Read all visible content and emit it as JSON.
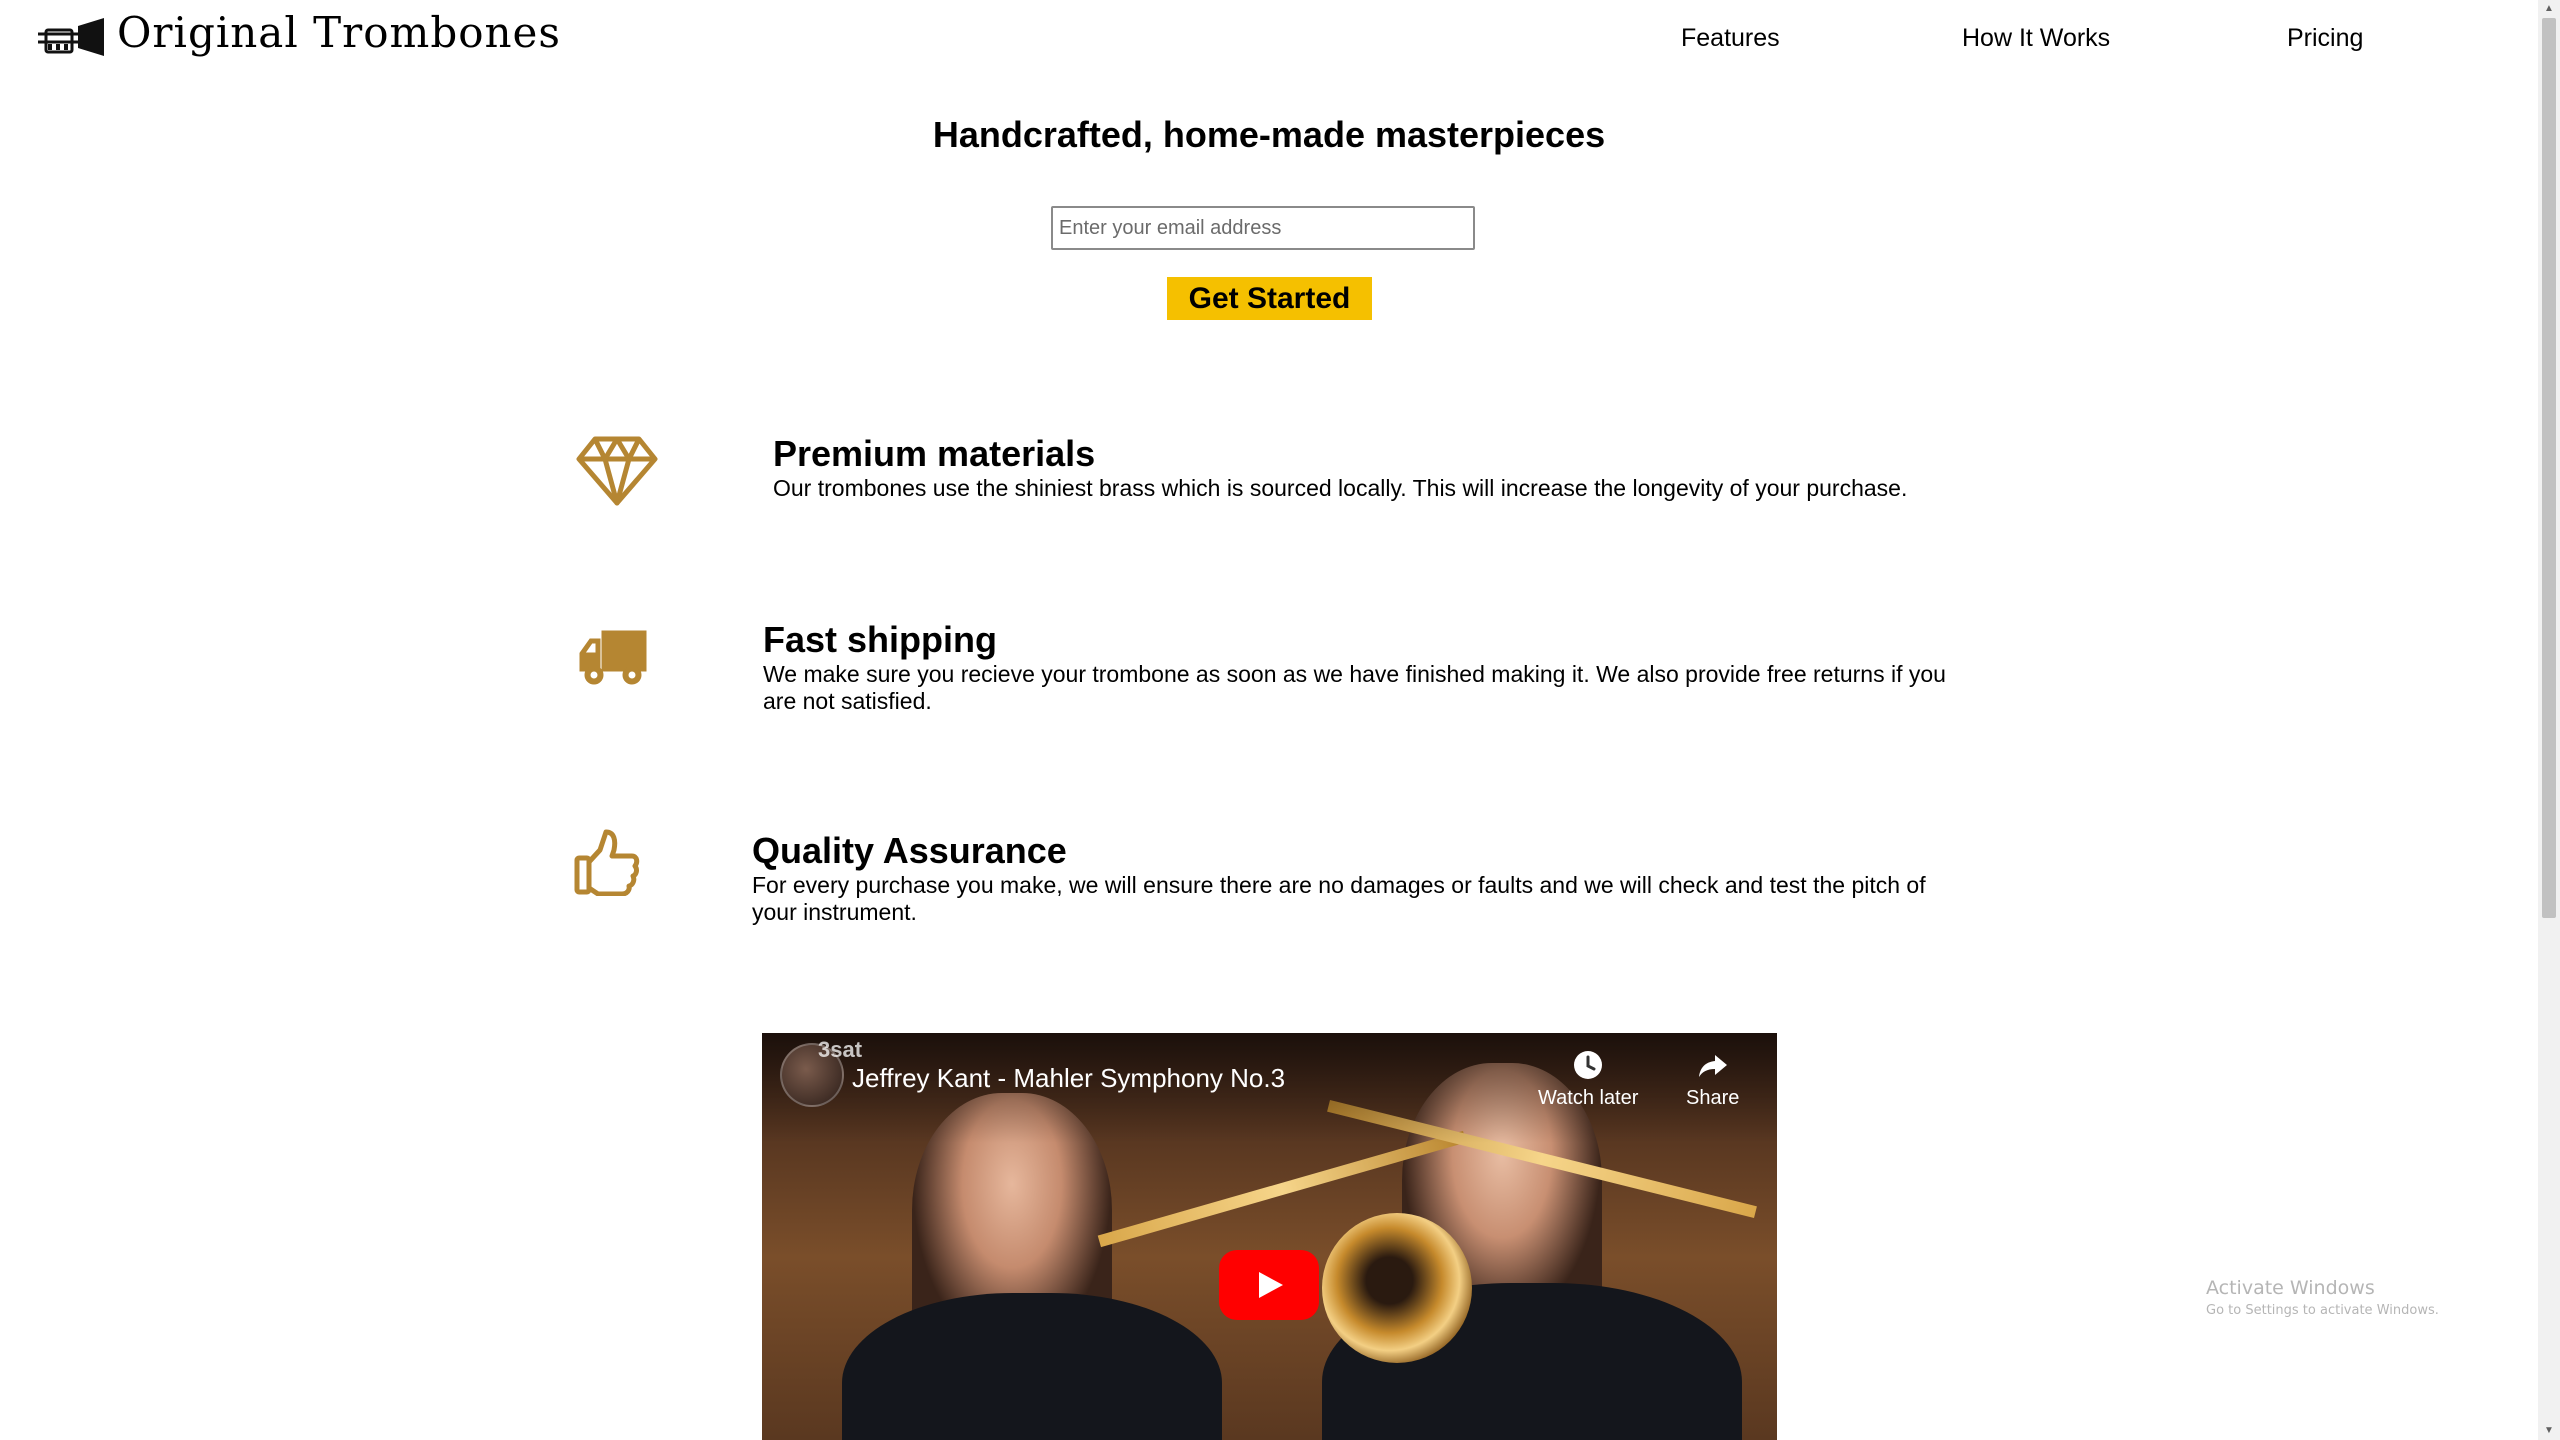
{
  "header": {
    "logo_text": "Original Trombones",
    "nav": [
      {
        "label": "Features"
      },
      {
        "label": "How It Works"
      },
      {
        "label": "Pricing"
      }
    ]
  },
  "hero": {
    "title": "Handcrafted, home-made masterpieces",
    "email_placeholder": "Enter your email address",
    "email_value": "",
    "cta_label": "Get Started"
  },
  "features": [
    {
      "icon": "diamond-icon",
      "title": "Premium materials",
      "text": "Our trombones use the shiniest brass which is sourced locally. This will increase the longevity of your purchase."
    },
    {
      "icon": "truck-icon",
      "title": "Fast shipping",
      "text": "We make sure you recieve your trombone as soon as we have finished making it. We also provide free returns if you are not satisfied."
    },
    {
      "icon": "thumbs-up-icon",
      "title": "Quality Assurance",
      "text": "For every purchase you make, we will ensure there are no damages or faults and we will check and test the pitch of your instrument."
    }
  ],
  "video": {
    "channel_badge": "3sat",
    "title": "Jeffrey Kant - Mahler Symphony No.3",
    "watch_later_label": "Watch later",
    "share_label": "Share"
  },
  "watermark": {
    "title": "Activate Windows",
    "subtitle": "Go to Settings to activate Windows."
  },
  "colors": {
    "accent": "#f5c000",
    "icon": "#b58632",
    "play": "#ff0000"
  }
}
